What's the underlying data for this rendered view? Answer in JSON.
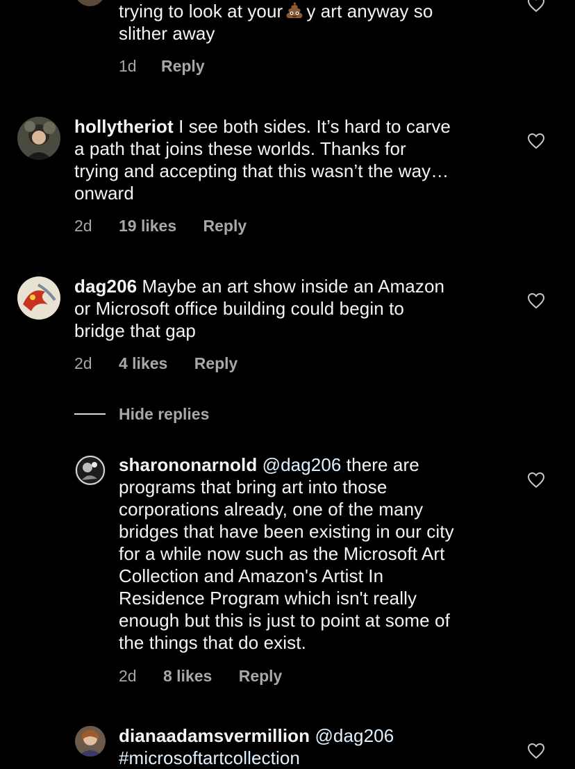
{
  "colors": {
    "background": "#000000",
    "primary_text": "#f5f5f5",
    "secondary_text": "#a8a8a8",
    "mention": "#e0f1ff"
  },
  "comments": [
    {
      "id": "partial-top",
      "text_lines": [
        "trying to look at your",
        "y art anyway so",
        "slither away"
      ],
      "emoji": "poop-emoji",
      "time": "1d",
      "reply_label": "Reply"
    },
    {
      "id": "hollytheriot",
      "username": "hollytheriot",
      "text_lines": [
        " I see both sides. It’s hard to carve",
        "a path that joins these worlds. Thanks for",
        "trying and accepting that this wasn’t the way…",
        "onward"
      ],
      "time": "2d",
      "likes": "19 likes",
      "reply_label": "Reply"
    },
    {
      "id": "dag206",
      "username": "dag206",
      "text_lines": [
        " Maybe an art show inside an Amazon",
        "or Microsoft office building could begin to",
        "bridge that gap"
      ],
      "time": "2d",
      "likes": "4 likes",
      "reply_label": "Reply"
    },
    {
      "id": "sharononarnold",
      "username": "sharononarnold",
      "mention": "@dag206",
      "text_lines": [
        " there are",
        "programs that bring art into those",
        "corporations already, one of the many",
        "bridges that have been existing in our city",
        "for a while now such as the Microsoft Art",
        "Collection and Amazon's Artist In",
        "Residence Program which isn't really",
        "enough but this is just to point at some of",
        "the things that do exist."
      ],
      "time": "2d",
      "likes": "8 likes",
      "reply_label": "Reply"
    },
    {
      "id": "dianaadamsvermillion",
      "username": "dianaadamsvermillion",
      "mention": "@dag206",
      "text_lines": [
        "#microsoftartcollection"
      ]
    }
  ],
  "hide_replies_label": "Hide replies"
}
